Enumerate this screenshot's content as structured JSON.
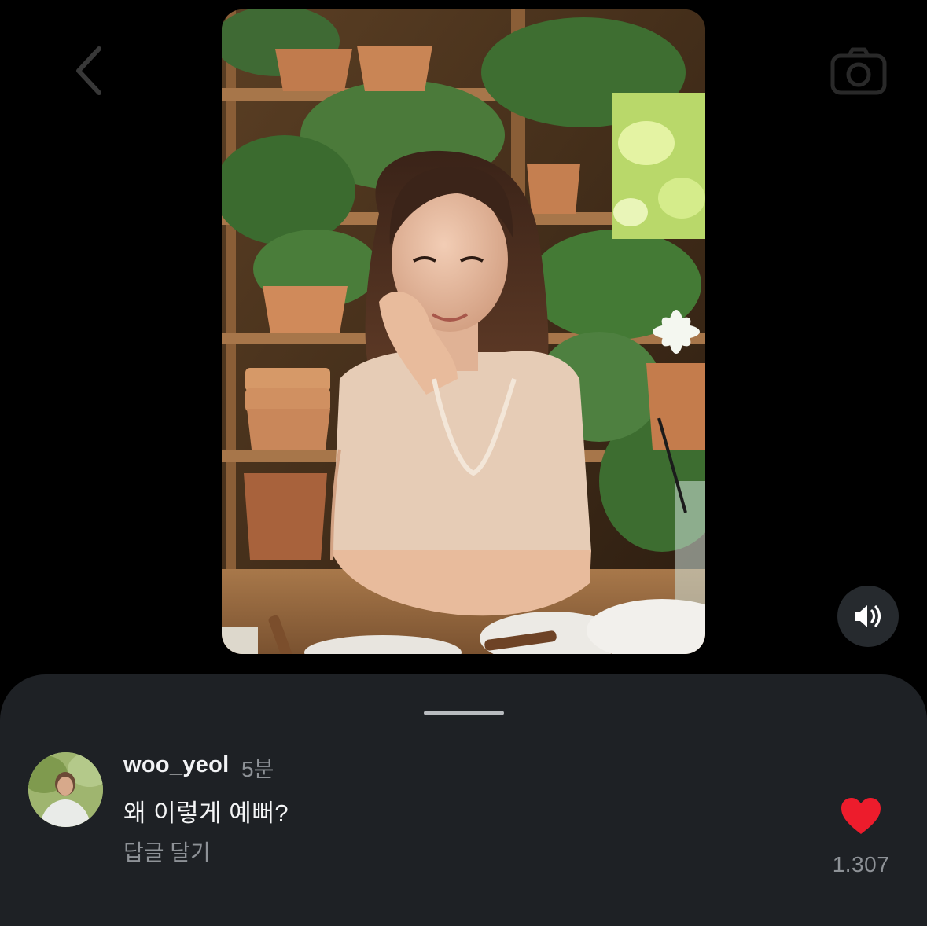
{
  "header": {
    "back_icon": "chevron-left-icon",
    "camera_icon": "camera-icon"
  },
  "media": {
    "sound_icon": "speaker-volume-icon"
  },
  "comment_sheet": {
    "comment": {
      "username": "woo_yeol",
      "time": "5분",
      "text": "왜 이렇게 예뻐?",
      "reply_label": "답글 달기",
      "likes": "1.307",
      "like_icon": "heart-filled-icon",
      "like_color": "#ed1c2c"
    }
  }
}
